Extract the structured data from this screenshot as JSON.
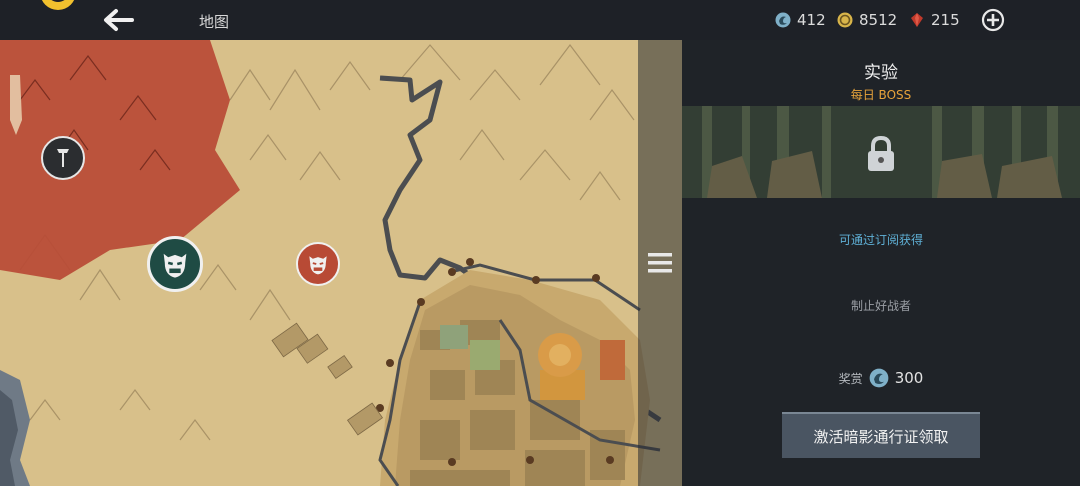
{
  "header": {
    "title": "地图",
    "back_icon": "back-arrow-icon",
    "logo_icon": "smiley-logo-icon"
  },
  "currencies": [
    {
      "name": "spirit",
      "icon": "swirl-orb-icon",
      "value": "412",
      "color": "#7fb0c8"
    },
    {
      "name": "gold",
      "icon": "gold-coin-icon",
      "value": "8512",
      "color": "#d9b54a"
    },
    {
      "name": "gem",
      "icon": "red-gem-icon",
      "value": "215",
      "color": "#c0392b"
    }
  ],
  "add_icon": "plus-circle-icon",
  "map": {
    "markers": [
      {
        "name": "gate-marker",
        "icon": "gate-icon"
      },
      {
        "name": "oni-boss-marker-selected",
        "icon": "oni-mask-icon"
      },
      {
        "name": "oni-boss-marker",
        "icon": "oni-mask-icon"
      }
    ],
    "menu_icon": "hamburger-menu-icon"
  },
  "panel": {
    "title": "实验",
    "subtitle": "每日 BOSS",
    "lock_icon": "padlock-icon",
    "link_text": "可通过订阅获得",
    "description": "制止好战者",
    "reward_label": "奖赏",
    "reward_icon": "swirl-orb-icon",
    "reward_value": "300",
    "button_label": "激活暗影通行证领取"
  },
  "colors": {
    "accent_orange": "#e8a33a",
    "link_blue": "#5fb0d6",
    "button_bg": "#4a5562",
    "enemy_red": "#b84a35",
    "map_parchment": "#d8c08a"
  }
}
